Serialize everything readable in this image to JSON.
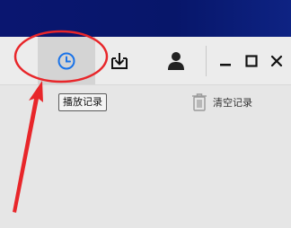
{
  "toolbar": {
    "buttons": [
      {
        "id": "history",
        "icon": "clock-icon",
        "selected": true
      },
      {
        "id": "download",
        "icon": "download-tray-icon"
      },
      {
        "id": "account",
        "icon": "user-icon"
      }
    ],
    "window_controls": [
      "minimize-icon",
      "maximize-icon",
      "close-icon"
    ]
  },
  "tooltip": {
    "text": "播放记录"
  },
  "history_panel": {
    "clear_label": "清空记录",
    "clear_icon": "trash-icon"
  },
  "colors": {
    "title_bar": "#0a1670",
    "accent": "#1a73e8",
    "annotation": "#e8262a",
    "selected_bg": "#d4d4d4"
  }
}
